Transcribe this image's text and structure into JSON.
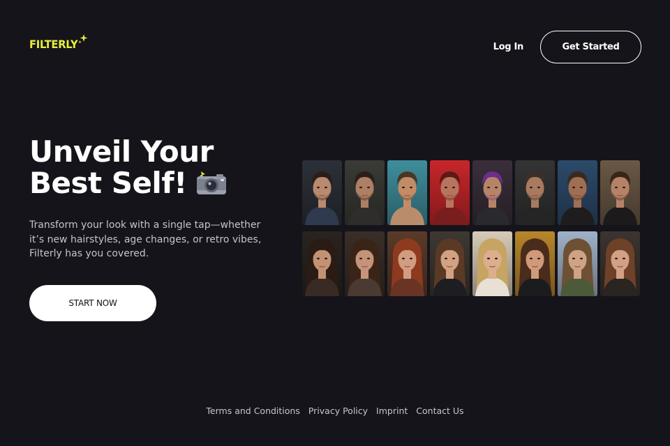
{
  "header": {
    "logo_text": "FILTERLY",
    "login_label": "Log In",
    "get_started_label": "Get Started"
  },
  "hero": {
    "title_line1": "Unveil Your",
    "title_line2": "Best Self!",
    "title_icon": "camera-with-flash-icon",
    "subtitle": "Transform your look with a single tap—whether it’s new hairstyles, age changes, or retro vibes, Filterly has you covered.",
    "cta_label": "START NOW"
  },
  "gallery": {
    "rows": [
      [
        {
          "name": "portrait-man-1",
          "bg": "#2c3038",
          "skin": "#b98a6e",
          "hair": "#2a1e18",
          "cloth": "#2f3a4e"
        },
        {
          "name": "portrait-man-2",
          "bg": "#3a3a36",
          "skin": "#ad7f63",
          "hair": "#2b2018",
          "cloth": "#2e2d2b"
        },
        {
          "name": "portrait-man-3",
          "bg": "#3f8e9c",
          "skin": "#c48c66",
          "hair": "#4a3624",
          "cloth": "#b98d6b"
        },
        {
          "name": "portrait-man-4",
          "bg": "#c8262a",
          "skin": "#b9745d",
          "hair": "#5a1a16",
          "cloth": "#7a1d1e"
        },
        {
          "name": "portrait-man-5",
          "bg": "#3a2e3a",
          "skin": "#b88468",
          "hair": "#6b2e8e",
          "cloth": "#2a2a2e"
        },
        {
          "name": "portrait-man-6",
          "bg": "#343434",
          "skin": "#a97a60",
          "hair": "#3b2f28",
          "cloth": "#252525"
        },
        {
          "name": "portrait-man-7",
          "bg": "#2d4a6a",
          "skin": "#a06e52",
          "hair": "#3a2a1e",
          "cloth": "#1e1c1c"
        },
        {
          "name": "portrait-man-8",
          "bg": "#6a5846",
          "skin": "#b68266",
          "hair": "#3a2418",
          "cloth": "#1c1a1a"
        }
      ],
      [
        {
          "name": "portrait-woman-1",
          "bg": "#2a2420",
          "skin": "#c39273",
          "hair": "#2a1c14",
          "cloth": "#3a2a24"
        },
        {
          "name": "portrait-woman-2",
          "bg": "#3a2e28",
          "skin": "#c5937a",
          "hair": "#3a2418",
          "cloth": "#4a3a32"
        },
        {
          "name": "portrait-woman-3",
          "bg": "#5a3a2a",
          "skin": "#d19c80",
          "hair": "#8e3a1e",
          "cloth": "#6a3424"
        },
        {
          "name": "portrait-woman-4",
          "bg": "#3e3832",
          "skin": "#d3a082",
          "hair": "#5a3a24",
          "cloth": "#1e1e22"
        },
        {
          "name": "portrait-woman-5",
          "bg": "#d6cbb8",
          "skin": "#dcae8c",
          "hair": "#c7a462",
          "cloth": "#e8e0d4"
        },
        {
          "name": "portrait-woman-6",
          "bg": "#b8862a",
          "skin": "#cf9a7a",
          "hair": "#4a2c1c",
          "cloth": "#1c1c1e"
        },
        {
          "name": "portrait-woman-7",
          "bg": "#9fb1c8",
          "skin": "#d0a284",
          "hair": "#6e5034",
          "cloth": "#4d5a3a"
        },
        {
          "name": "portrait-woman-8",
          "bg": "#3c3430",
          "skin": "#d2a084",
          "hair": "#6e4228",
          "cloth": "#2a2422"
        }
      ]
    ]
  },
  "footer": {
    "links": [
      "Terms and Conditions",
      "Privacy Policy",
      "Imprint",
      "Contact Us"
    ]
  },
  "colors": {
    "background": "#15141a",
    "logo_accent": "#e7ef3a",
    "text_primary": "#ffffff",
    "text_muted": "#c4c4cc"
  }
}
